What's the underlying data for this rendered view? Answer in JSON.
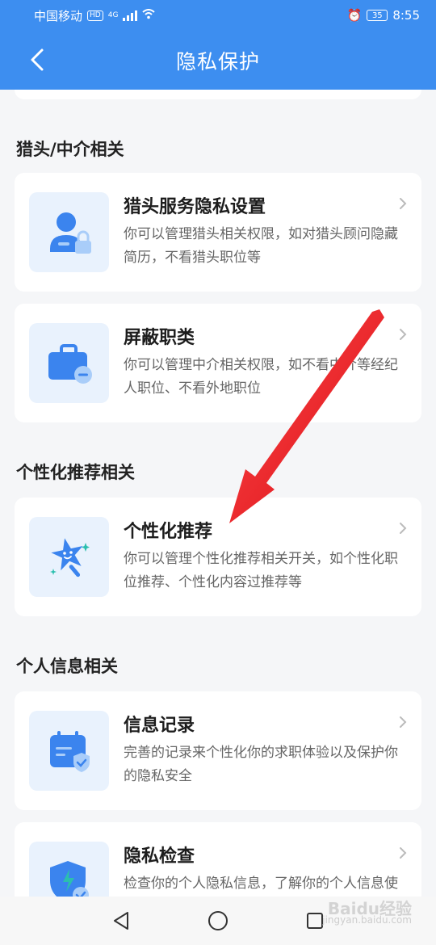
{
  "status_bar": {
    "carrier": "中国移动",
    "hd_badge": "HD",
    "network": "4G",
    "battery": "35",
    "time": "8:55"
  },
  "nav": {
    "title": "隐私保护"
  },
  "sections": [
    {
      "title": "猎头/中介相关",
      "cards": [
        {
          "title": "猎头服务隐私设置",
          "desc": "你可以管理猎头相关权限，如对猎头顾问隐藏简历，不看猎头职位等",
          "icon": "person-lock-icon"
        },
        {
          "title": "屏蔽职类",
          "desc": "你可以管理中介相关权限，如不看中介等经纪人职位、不看外地职位",
          "icon": "briefcase-minus-icon"
        }
      ]
    },
    {
      "title": "个性化推荐相关",
      "cards": [
        {
          "title": "个性化推荐",
          "desc": "你可以管理个性化推荐相关开关，如个性化职位推荐、个性化内容过推荐等",
          "icon": "star-wand-icon"
        }
      ]
    },
    {
      "title": "个人信息相关",
      "cards": [
        {
          "title": "信息记录",
          "desc": "完善的记录来个性化你的求职体验以及保护你的隐私安全",
          "icon": "calendar-shield-icon"
        },
        {
          "title": "隐私检查",
          "desc": "检查你的个人隐私信息，了解你的个人信息使用状态",
          "icon": "shield-check-icon"
        }
      ]
    }
  ],
  "watermark": {
    "brand": "Baidu经验",
    "url": "jingyan.baidu.com"
  },
  "colors": {
    "primary": "#3d8ef0",
    "icon_bg": "#e9f2fd",
    "arrow": "#e8141b"
  }
}
